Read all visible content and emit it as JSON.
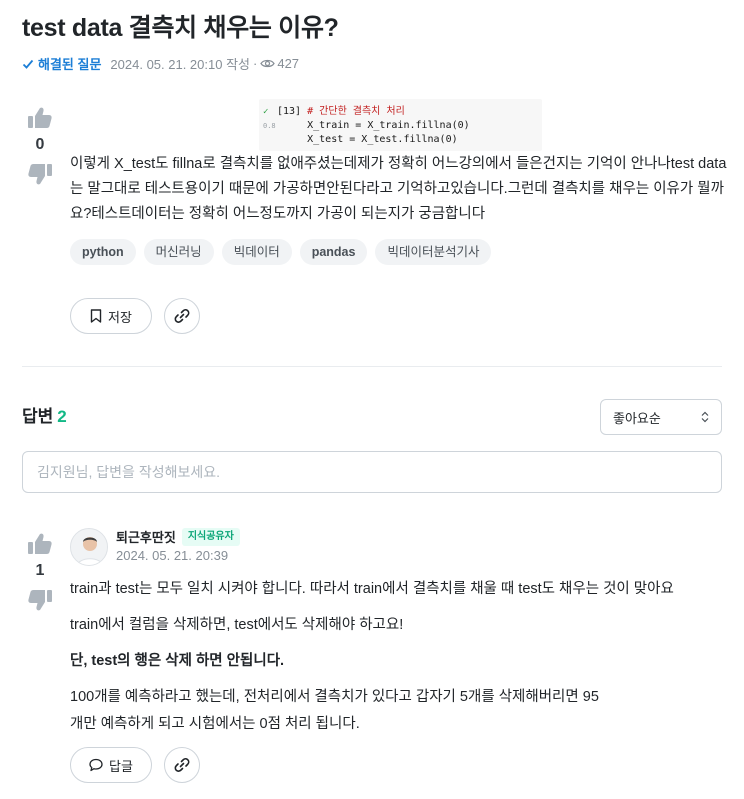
{
  "question": {
    "title": "test data 결측치 채우는 이유?",
    "status": "해결된 질문",
    "datetime": "2024. 05. 21. 20:10 작성",
    "views": "427",
    "votes": "0",
    "code_snippet": {
      "cell_label": "[13]",
      "gutter_label": "0.8",
      "comment": "# 간단한 결측치 처리",
      "line2": "X_train = X_train.fillna(0)",
      "line3": "X_test = X_test.fillna(0)"
    },
    "body": "이렇게 X_test도 fillna로 결측치를 없애주셨는데제가 정확히 어느강의에서 들은건지는 기억이 안나나test data는 말그대로 테스트용이기 때문에 가공하면안된다라고 기억하고있습니다.그런데 결측치를 채우는 이유가 뭘까요?테스트데이터는 정확히 어느정도까지 가공이 되는지가 궁금합니다",
    "tags": [
      "python",
      "머신러닝",
      "빅데이터",
      "pandas",
      "빅데이터분석기사"
    ],
    "save_label": "저장"
  },
  "answers_section": {
    "label": "답변",
    "count": "2",
    "sort": "좋아요순",
    "input_placeholder": "김지원님, 답변을 작성해보세요."
  },
  "answer": {
    "author": "퇴근후딴짓",
    "badge": "지식공유자",
    "datetime": "2024. 05. 21. 20:39",
    "votes": "1",
    "paragraphs": [
      "train과 test는 모두 일치 시켜야 합니다. 따라서 train에서 결측치를 채울 때 test도 채우는 것이 맞아요",
      "train에서 컬럼을 삭제하면, test에서도 삭제해야 하고요!",
      "단, test의 행은 삭제 하면 안됩니다.",
      "100개를 예측하라고 했는데, 전처리에서 결측치가 있다고 갑자기 5개를 삭제해버리면 95개만 예측하게 되고 시험에서는 0점 처리 됩니다."
    ],
    "reply_label": "답글"
  },
  "colors": {
    "resolved": "#1c7ed6",
    "accent_count": "#12b886",
    "badge_text": "#0ca678",
    "badge_bg": "#e6fcf5",
    "tag_bg": "#f1f3f5",
    "thumb_icon": "#adb5bd"
  }
}
